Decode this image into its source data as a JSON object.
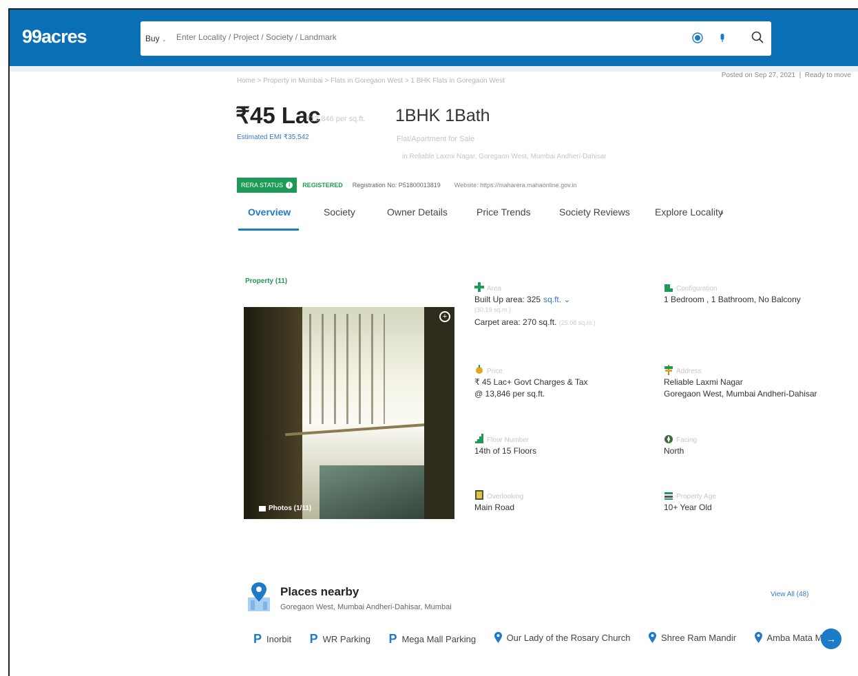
{
  "header": {
    "logo": "99acres",
    "buy_label": "Buy",
    "search_placeholder": "Enter Locality / Project / Society / Landmark"
  },
  "breadcrumb": "Home > Property in Mumbai > Flats in Goregaon West > 1 BHK Flats in Goregaon West",
  "posted": {
    "date": "Posted on Sep 27, 2021",
    "status": "Ready to move"
  },
  "summary": {
    "price": "₹45 Lac",
    "price_per_sqft": "₹13,846 per sq.ft.",
    "emi": "Estimated EMI ₹35,542",
    "configuration": "1BHK 1Bath",
    "property_type": "Flat/Apartment for Sale",
    "address_line": "in Reliable Laxmi Nagar, Goregaon West, Mumbai Andheri-Dahisar"
  },
  "rera": {
    "status_label": "RERA STATUS",
    "registered": "REGISTERED",
    "registration": "Registration No: P51800013819",
    "website": "Website: https://maharera.mahaonline.gov.in"
  },
  "tabs": [
    "Overview",
    "Society",
    "Owner Details",
    "Price Trends",
    "Society Reviews",
    "Explore Locality"
  ],
  "photos": {
    "label": "Property (11)",
    "caption": "Photos (1/11)"
  },
  "details": {
    "area": {
      "label": "Area",
      "built_up": "Built Up area: 325",
      "unit": "sq.ft.",
      "built_up_sub": "(30.19 sq.m.)",
      "carpet": "Carpet area: 270 sq.ft.",
      "carpet_sub": "(25.08 sq.m.)"
    },
    "configuration": {
      "label": "Configuration",
      "value": "1 Bedroom , 1 Bathroom, No Balcony"
    },
    "price": {
      "label": "Price",
      "value": "₹ 45 Lac+ Govt Charges & Tax",
      "per_sqft": "@ 13,846 per sq.ft."
    },
    "address": {
      "label": "Address",
      "line1": "Reliable Laxmi Nagar",
      "line2": "Goregaon West, Mumbai Andheri-Dahisar"
    },
    "floor": {
      "label": "Floor Number",
      "value": "14th of 15 Floors"
    },
    "facing": {
      "label": "Facing",
      "value": "North"
    },
    "overlooking": {
      "label": "Overlooking",
      "value": "Main Road"
    },
    "age": {
      "label": "Property Age",
      "value": "10+ Year Old"
    }
  },
  "places": {
    "title": "Places nearby",
    "subtitle": "Goregaon West, Mumbai Andheri-Dahisar, Mumbai",
    "view_all": "View All (48)",
    "items": [
      {
        "type": "parking",
        "name": "Inorbit"
      },
      {
        "type": "parking",
        "name": "WR Parking"
      },
      {
        "type": "parking",
        "name": "Mega Mall Parking"
      },
      {
        "type": "place",
        "name": "Our Lady of the Rosary Church"
      },
      {
        "type": "place",
        "name": "Shree Ram Mandir"
      },
      {
        "type": "place",
        "name": "Amba Mata Mandir"
      }
    ]
  },
  "colors": {
    "brand_blue": "#0a6fb5",
    "link_blue": "#1c7ac8",
    "rera_green": "#1d9a55"
  },
  "icons": [
    "search-icon",
    "location-icon",
    "mic-icon",
    "zoom-icon",
    "chevron-right-icon",
    "map-pin-icon"
  ]
}
